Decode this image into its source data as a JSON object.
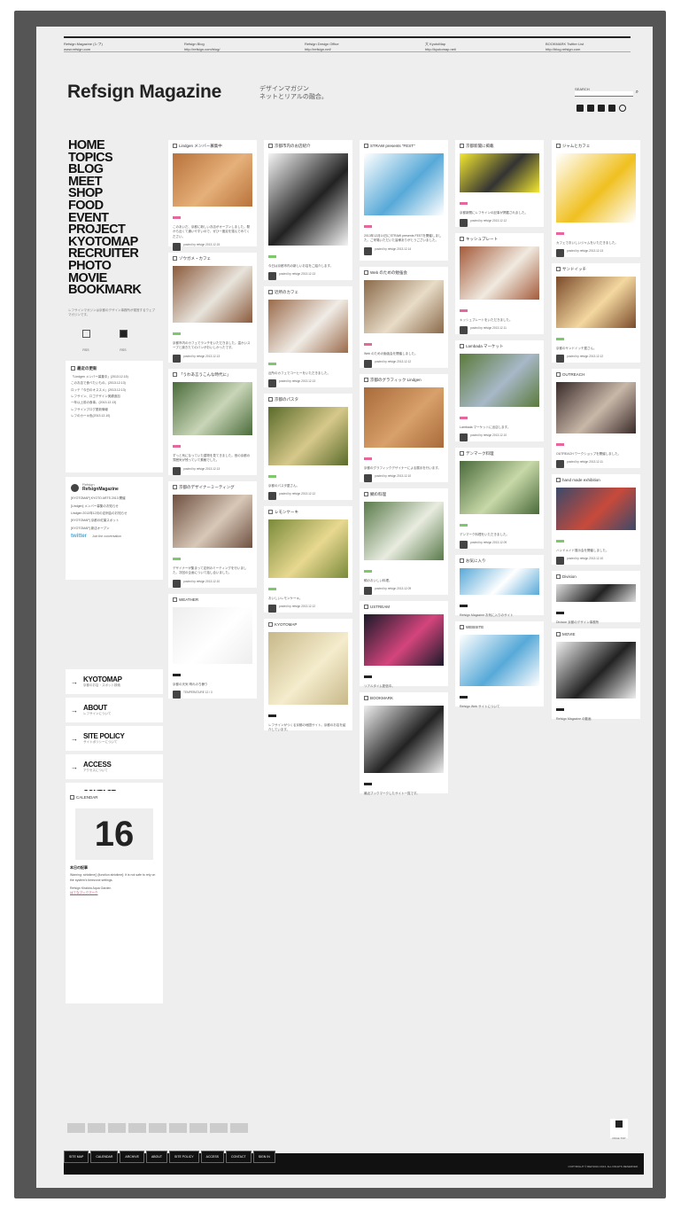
{
  "header": {
    "top_links": [
      {
        "title": "Refsign Magazine (レフ)",
        "url": "www.refsign.com"
      },
      {
        "title": "Refsign Blog",
        "url": "http://refsign.com/blog/"
      },
      {
        "title": "Refsign Design Office",
        "url": "http://refsign.net/"
      },
      {
        "title": "大 KyotoMap",
        "url": "http://kyotomap.net/"
      },
      {
        "title": "BOOKMARK Twitter List",
        "url": "http://blog.refsign.com"
      }
    ],
    "logo": "Refsign Magazine",
    "tagline_1": "デザインマガジン",
    "tagline_2": "ネットとリアルの融合。",
    "search_label": "SEARCH",
    "search_placeholder": "",
    "social_icons": [
      "home-icon",
      "twitter-icon",
      "mail-icon",
      "rss-icon",
      "circle-icon"
    ]
  },
  "nav": {
    "items": [
      "HOME",
      "TOPICS",
      "BLOG",
      "MEET",
      "SHOP",
      "FOOD",
      "EVENT",
      "PROJECT",
      "KYOTOMAP",
      "RECRUITER",
      "PHOTO",
      "MOVIE",
      "BOOKMARK"
    ],
    "note": "レフサインマガジンは京都のデザイン事務所が運営するウェブマガジンです。",
    "feed_left": "RSS FEED",
    "feed_right": "RSS FEED"
  },
  "left": {
    "recent_title": "最近の更新",
    "recent_items": [
      "「Lindgen メンバー募集中」(2013.12.15)",
      "このお店で食べたいもの。(2013.12.13)",
      "ロッテ「今日のオススメ」(2013.12.13)",
      "レフサイン、ロゴデザイン実績追加",
      "一年以上前の食事。(2013.12.13)",
      "レフサインブログ更新情報",
      "レフのカーキ色(2013.12.10)"
    ],
    "twitter_title": "Refsign",
    "twitter_handle": "RefsignMagazine",
    "tweets": [
      "[KYOTOMAP] KYOTO ARTS 2013 開催",
      "[Lindgen] メンバー募集のお知らせ",
      "Lindgen 2013年12月の定例会のお知らせ",
      "[KYOTOMAP] 京都の紅葉スポット",
      "[KYOTOMAP] 新店オープン"
    ],
    "twitter_footer": "twitter",
    "twitter_follow": "Join the conversation",
    "links": [
      {
        "title": "KYOTOMAP",
        "sub": "京都のお店・スポット検索"
      },
      {
        "title": "ABOUT",
        "sub": "レフサインについて"
      },
      {
        "title": "SITE POLICY",
        "sub": "サイトポリシーについて"
      },
      {
        "title": "ACCESS",
        "sub": "アクセスについて"
      },
      {
        "title": "CONTACT",
        "sub": "取材・掲載・お問い合わせ"
      }
    ],
    "calendar_title": "CALENDAR",
    "calendar_day": "16",
    "calendar_label": "本日の記事",
    "calendar_text": "Warning: strtotime() [function.strtotime]: It is not safe to rely on the system's timezone settings.",
    "calendar_text2": "Refsign Kirakira Aqua Garden",
    "calendar_link": "はてなブックマーク"
  },
  "columns": [
    [
      {
        "title": "Lindgen メンバー募集中",
        "img": "#b8723a",
        "img2": "#e6b07a",
        "h": 60,
        "tag": "#e8669e",
        "text": "このあいだ、京都に新しいお店がオープンしました。駅から近くて通いやすいので、ぜひ一度足を運んでみてください。",
        "meta": "posted by refsign 2013.12.15"
      },
      {
        "title": "ゾウガメ・カフェ",
        "img": "#8b5a3c",
        "img2": "#e8e4dc",
        "h": 64,
        "tag": "#7cc86a",
        "text": "京都市内のカフェでランチをいただきました。温かいスープと焼きたてのパンがおいしかったです。",
        "meta": "posted by refsign 2013.12.13"
      },
      {
        "title": "「うわあ言うこんな時代に」",
        "img": "#4a6b3a",
        "img2": "#c9d6b8",
        "h": 60,
        "tag": "#e8669e",
        "text": "ずっと気になっていた建物を見てきました。昔の京都の雰囲気が残っていて素敵でした。",
        "meta": "posted by refsign 2013.12.13"
      },
      {
        "title": "京都のデザイナーミーティング",
        "img": "#6e5040",
        "img2": "#d8c8b8",
        "h": 60,
        "tag": "#7cc86a",
        "text": "デザイナーが集まって定例のミーティングを行いました。次回の企画について話し合いました。",
        "meta": "posted by refsign 2013.12.10"
      },
      {
        "title": "WEATHER",
        "img": "#eeeeee",
        "img2": "#ffffff",
        "h": 64,
        "tag": "#222222",
        "text": "京都の天気 晴れのち曇り",
        "meta": "TEMPERATURE 12 / 3"
      }
    ],
    [
      {
        "title": "京都市内のお店紹介",
        "img": "#f4f4f4",
        "img2": "#222222",
        "h": 104,
        "tag": "#7cc86a",
        "text": "今日は京都市内の新しいお店をご紹介します。",
        "meta": "posted by refsign 2013.12.13"
      },
      {
        "title": "近所のカフェ",
        "img": "#9a6a4a",
        "img2": "#f0ece6",
        "h": 60,
        "tag": "#7cc86a",
        "text": "近所のカフェでコーヒーをいただきました。",
        "meta": "posted by refsign 2013.12.13"
      },
      {
        "title": "京都のパスタ",
        "img": "#5a6b2a",
        "img2": "#d6c88a",
        "h": 66,
        "tag": "#7cc86a",
        "text": "京都のパスタ屋さん。",
        "meta": "posted by refsign 2013.12.12"
      },
      {
        "title": "レモンケーキ",
        "img": "#7a8a3a",
        "img2": "#e8d890",
        "h": 66,
        "tag": "#7cc86a",
        "text": "おいしいレモンケーキ。",
        "meta": "posted by refsign 2013.12.12"
      },
      {
        "title": "KYOTOMAP",
        "img": "#c8b88a",
        "img2": "#f4eccc",
        "h": 82,
        "tag": "#222222",
        "text": "レフサインがつくる京都の地図サイト。京都のお店を紹介しています。",
        "meta": ""
      }
    ],
    [
      {
        "title": "STRAW presents \"FEST\"",
        "img": "#ffffff",
        "img2": "#57a9d8",
        "h": 70,
        "tag": "#e8669e",
        "text": "2013年12月14日にSTRAW presents FESTを開催しました。ご来場いただいた皆様ありがとうございました。",
        "meta": "posted by refsign 2013.12.14"
      },
      {
        "title": "Web のための勉強会",
        "img": "#8a6a4a",
        "img2": "#e8dcc8",
        "h": 60,
        "tag": "#e8669e",
        "text": "Web のための勉強会を開催しました。",
        "meta": "posted by refsign 2013.12.12"
      },
      {
        "title": "京都のグラフィック Lindgen",
        "img": "#a86a3a",
        "img2": "#d8a06a",
        "h": 68,
        "tag": "#e8669e",
        "text": "京都のグラフィックデザイナーによる展示を行います。",
        "meta": "posted by refsign 2013.12.10"
      },
      {
        "title": "鯛の料理",
        "img": "#5a7a4a",
        "img2": "#e8ece0",
        "h": 66,
        "tag": "#7cc86a",
        "text": "鯛のおいしい料理。",
        "meta": "posted by refsign 2013.12.09"
      },
      {
        "title": "USTREAM",
        "img": "#1a1a2a",
        "img2": "#d4457c",
        "h": 58,
        "tag": "#222222",
        "text": "リアルタイム配信中。",
        "meta": ""
      },
      {
        "title": "BOOKMARK",
        "img": "#eeeeee",
        "img2": "#222222",
        "h": 76,
        "tag": "#222222",
        "text": "最近ブックマークしたサイト一覧です。",
        "meta": ""
      }
    ],
    [
      {
        "title": "京都新聞に掲載",
        "img": "#f4e830",
        "img2": "#333333",
        "h": 44,
        "tag": "#e8669e",
        "text": "京都新聞にレフサインの記事が掲載されました。",
        "meta": "posted by refsign 2013.12.12"
      },
      {
        "title": "キッシュプレート",
        "img": "#a45a3a",
        "img2": "#f0eae0",
        "h": 60,
        "tag": "#e8669e",
        "text": "キッシュプレートをいただきました。",
        "meta": "posted by refsign 2013.12.11"
      },
      {
        "title": "Lambada マーケット",
        "img": "#5a7a3a",
        "img2": "#a8b8c8",
        "h": 60,
        "tag": "#e8669e",
        "text": "Lambada マーケットに出店します。",
        "meta": "posted by refsign 2013.12.10"
      },
      {
        "title": "デンマーク料理",
        "img": "#4a6a3a",
        "img2": "#c8d8a8",
        "h": 60,
        "tag": "#7cc86a",
        "text": "デンマーク料理をいただきました。",
        "meta": "posted by refsign 2013.12.09"
      },
      {
        "title": "お気に入り",
        "img": "#57a9d8",
        "img2": "#ffffff",
        "h": 30,
        "tag": "#222222",
        "text": "Refsign Magazine お気に入りのサイト",
        "meta": ""
      },
      {
        "title": "WEBSITE",
        "img": "#ffffff",
        "img2": "#57a9d8",
        "h": 58,
        "tag": "#222222",
        "text": "Refsign Web サイトについて",
        "meta": ""
      }
    ],
    [
      {
        "title": "ジャムとカフェ",
        "img": "#ffffff",
        "img2": "#f0c020",
        "h": 78,
        "tag": "#e8669e",
        "text": "カフェでおいしいジャムをいただきました。",
        "meta": "posted by refsign 2013.12.13"
      },
      {
        "title": "サンドイッチ",
        "img": "#7a4a2a",
        "img2": "#f4d8a0",
        "h": 58,
        "tag": "#7cc86a",
        "text": "京都のサンドイッチ屋さん。",
        "meta": "posted by refsign 2013.12.12"
      },
      {
        "title": "OUTREACH",
        "img": "#3a2a2a",
        "img2": "#c8b8a8",
        "h": 58,
        "tag": "#e8669e",
        "text": "OUTREACH ワークショップを開催しました。",
        "meta": "posted by refsign 2013.12.11"
      },
      {
        "title": "hand made exhibition",
        "img": "#3a4a6a",
        "img2": "#c84a3a",
        "h": 48,
        "tag": "#7cc86a",
        "text": "ハンドメイド展示会を開催しました。",
        "meta": "posted by refsign 2013.12.10"
      },
      {
        "title": "Division",
        "img": "#dddddd",
        "img2": "#222222",
        "h": 20,
        "tag": "#222222",
        "text": "Division 京都のデザイン事務所",
        "meta": ""
      },
      {
        "title": "MOVIE",
        "img": "#eeeeee",
        "img2": "#222222",
        "h": 64,
        "tag": "#222222",
        "text": "Refsign Magazine の動画",
        "meta": ""
      }
    ]
  ],
  "footer": {
    "nav": [
      "SITE MAP",
      "CALENDAR",
      "ARCHIVE",
      "ABOUT",
      "SITE POLICY",
      "ACCESS",
      "CONTACT",
      "SIGN IN"
    ],
    "copyright": "COPYRIGHT © REFSIGN 2013. ALL RIGHTS RESERVED.",
    "page_top": "PAGE TOP"
  },
  "colors": {
    "pink": "#e8669e",
    "green": "#7cc86a",
    "blue": "#57a9d8",
    "frame": "#555555",
    "page_bg": "#eeeeee"
  }
}
